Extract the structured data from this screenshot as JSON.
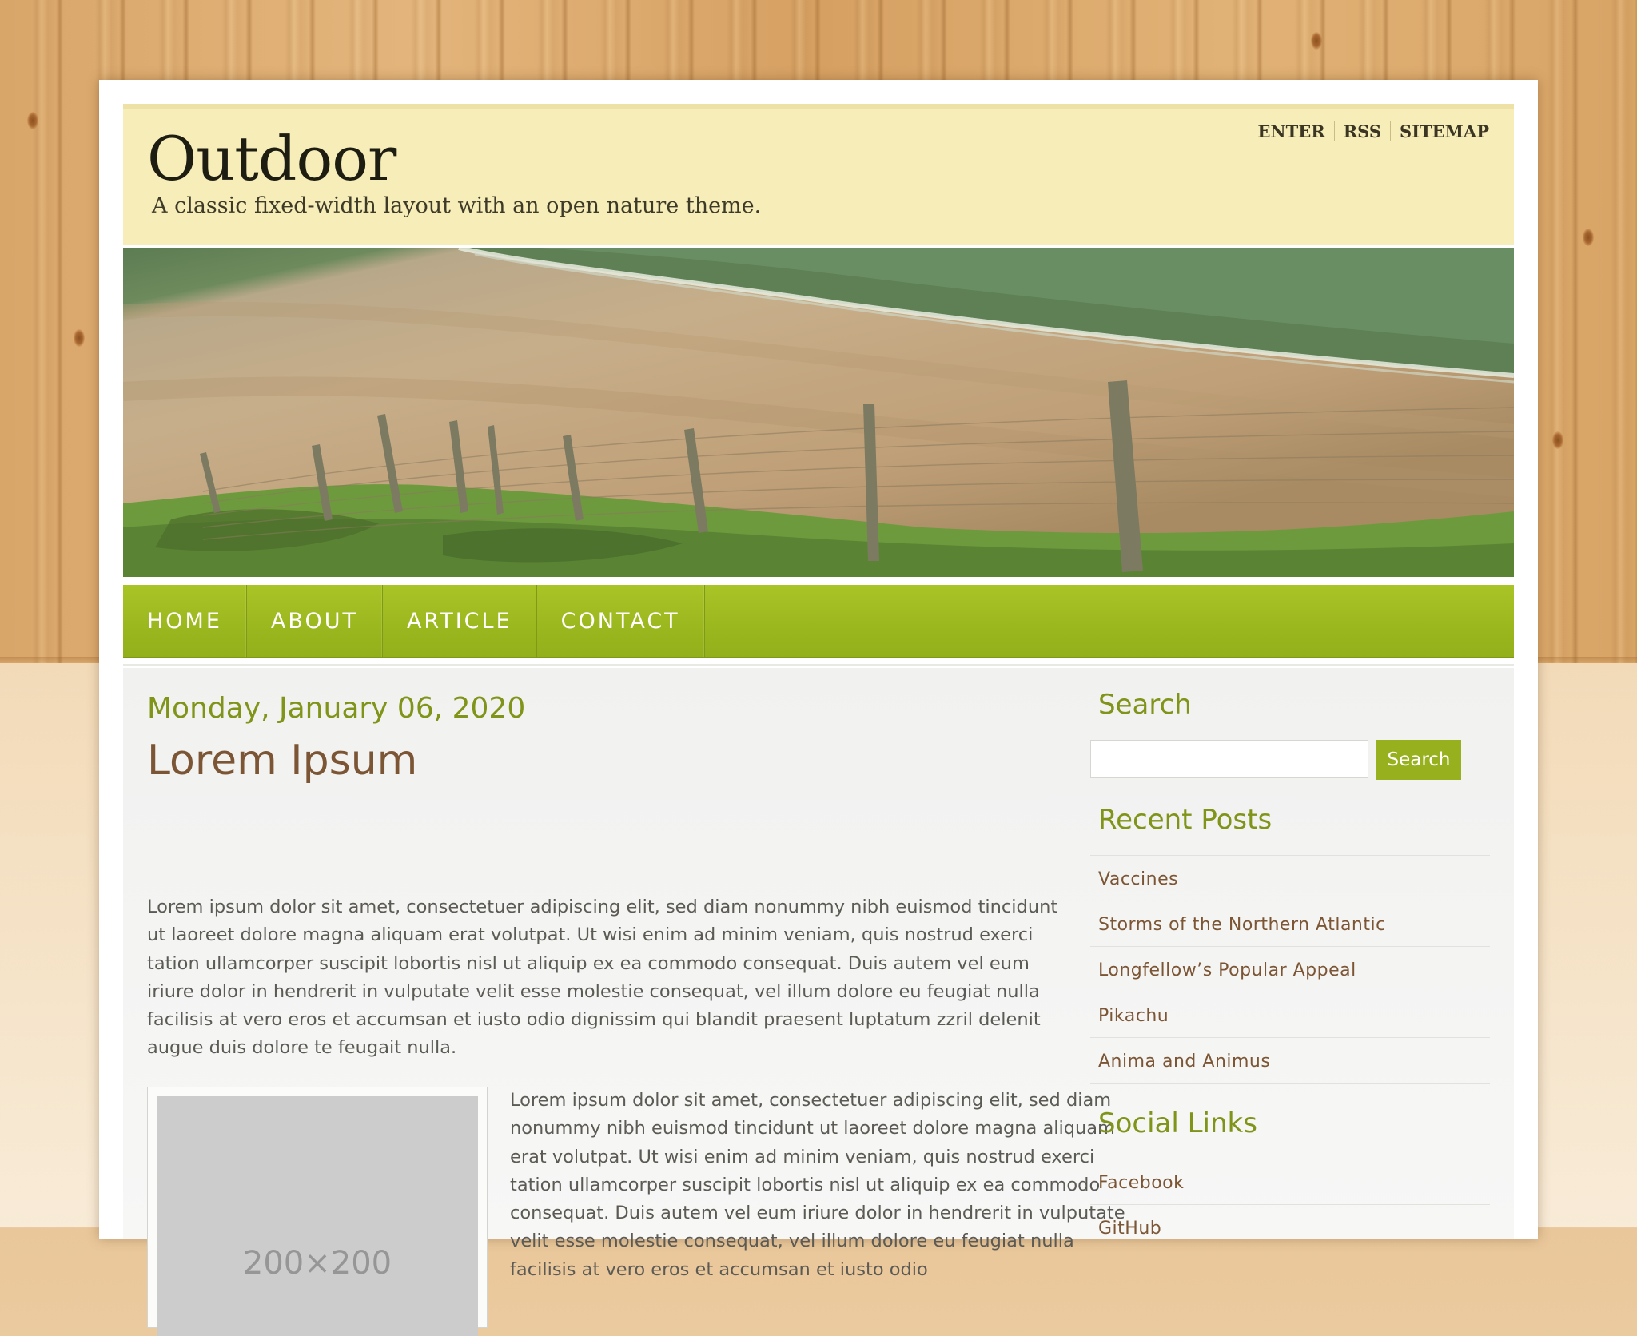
{
  "site": {
    "title": "Outdoor",
    "tagline": "A classic fixed-width layout with an open nature theme."
  },
  "top_links": [
    "ENTER",
    "RSS",
    "SITEMAP"
  ],
  "nav": [
    "HOME",
    "ABOUT",
    "ARTICLE",
    "CONTACT"
  ],
  "post": {
    "date": "Monday, January 06, 2020",
    "title": "Lorem Ipsum",
    "paragraph_1": "Lorem ipsum dolor sit amet, consectetuer adipiscing elit, sed diam nonummy nibh euismod tincidunt ut laoreet dolore magna aliquam erat volutpat. Ut wisi enim ad minim veniam, quis nostrud exerci tation ullamcorper suscipit lobortis nisl ut aliquip ex ea commodo consequat. Duis autem vel eum iriure dolor in hendrerit in vulputate velit esse molestie consequat, vel illum dolore eu feugiat nulla facilisis at vero eros et accumsan et iusto odio dignissim qui blandit praesent luptatum zzril delenit augue duis dolore te feugait nulla.",
    "paragraph_2": "Lorem ipsum dolor sit amet, consectetuer adipiscing elit, sed diam nonummy nibh euismod tincidunt ut laoreet dolore magna aliquam erat volutpat. Ut wisi enim ad minim veniam, quis nostrud exerci tation ullamcorper suscipit lobortis nisl ut aliquip ex ea commodo consequat. Duis autem vel eum iriure dolor in hendrerit in vulputate velit esse molestie consequat, vel illum dolore eu feugiat nulla facilisis at vero eros et accumsan et iusto odio",
    "image_placeholder": "200×200"
  },
  "sidebar": {
    "search": {
      "heading": "Search",
      "input_value": "",
      "button": "Search"
    },
    "recent_posts": {
      "heading": "Recent Posts",
      "items": [
        "Vaccines",
        "Storms of the Northern Atlantic",
        "Longfellow’s Popular Appeal",
        "Pikachu",
        "Anima and Animus"
      ]
    },
    "social_links": {
      "heading": "Social Links",
      "items": [
        "Facebook",
        "GitHub"
      ]
    }
  },
  "colors": {
    "accent_green": "#97b11e",
    "header_bg": "#f7edb9",
    "heading_brown": "#7b5534",
    "date_green": "#7f9418"
  }
}
